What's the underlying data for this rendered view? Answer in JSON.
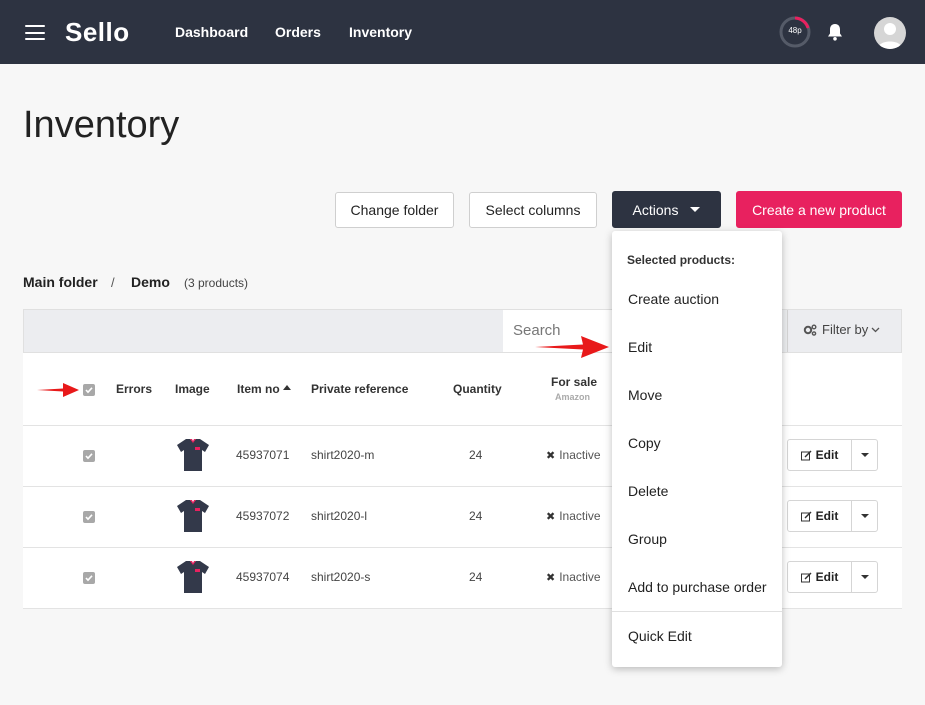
{
  "app": {
    "logo": "Sello"
  },
  "nav": {
    "links": [
      "Dashboard",
      "Orders",
      "Inventory"
    ],
    "progress_label": "48p"
  },
  "page": {
    "title": "Inventory"
  },
  "toolbar": {
    "change_folder": "Change folder",
    "select_columns": "Select columns",
    "actions": "Actions",
    "create": "Create a new product"
  },
  "breadcrumb": {
    "main": "Main folder",
    "sep": "/",
    "current": "Demo",
    "count": "(3 products)"
  },
  "filter": {
    "search_placeholder": "Search",
    "filter_by": "Filter by"
  },
  "table": {
    "headers": {
      "errors": "Errors",
      "image": "Image",
      "item_no": "Item no",
      "private_reference": "Private reference",
      "quantity": "Quantity",
      "for_sale": "For sale",
      "for_sale_sub": "Amazon"
    },
    "rows": [
      {
        "item_no": "45937071",
        "ref": "shirt2020-m",
        "qty": "24",
        "status": "Inactive",
        "edit": "Edit"
      },
      {
        "item_no": "45937072",
        "ref": "shirt2020-l",
        "qty": "24",
        "status": "Inactive",
        "edit": "Edit"
      },
      {
        "item_no": "45937074",
        "ref": "shirt2020-s",
        "qty": "24",
        "status": "Inactive",
        "edit": "Edit"
      }
    ]
  },
  "dropdown": {
    "header": "Selected products:",
    "items": [
      "Create auction",
      "Edit",
      "Move",
      "Copy",
      "Delete",
      "Group",
      "Add to purchase order",
      "Quick Edit"
    ]
  },
  "colors": {
    "navbar": "#2d3341",
    "accent_pink": "#e8215f",
    "annotation_red": "#e8191a"
  }
}
